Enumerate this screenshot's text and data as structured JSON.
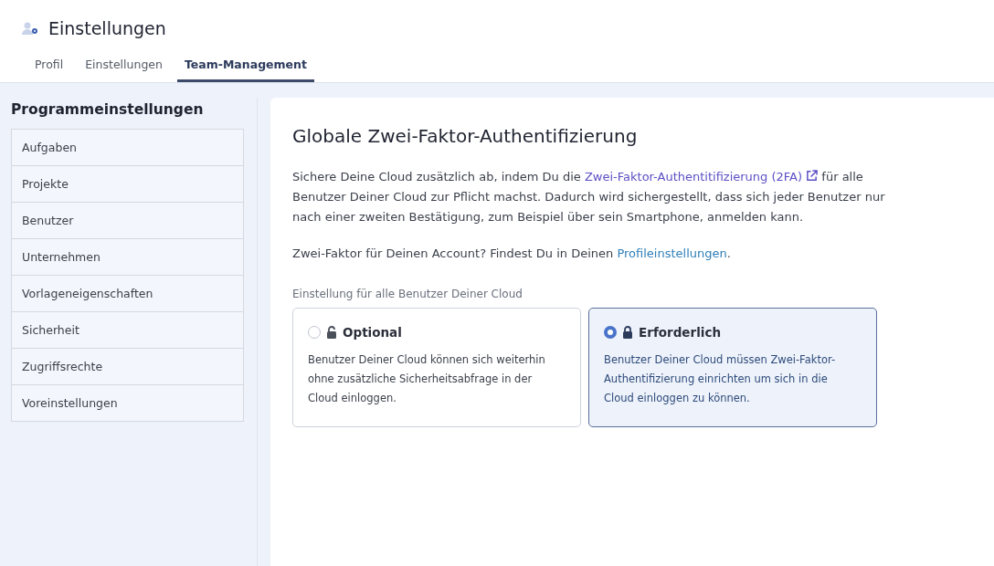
{
  "header": {
    "title": "Einstellungen"
  },
  "tabs": [
    {
      "label": "Profil",
      "selected": false
    },
    {
      "label": "Einstellungen",
      "selected": false
    },
    {
      "label": "Team-Management",
      "selected": true
    }
  ],
  "sidebar": {
    "title": "Programmeinstellungen",
    "items": [
      {
        "label": "Aufgaben",
        "selected": false
      },
      {
        "label": "Projekte",
        "selected": false
      },
      {
        "label": "Benutzer",
        "selected": false
      },
      {
        "label": "Unternehmen",
        "selected": false
      },
      {
        "label": "Vorlageneigenschaften",
        "selected": false
      },
      {
        "label": "Sicherheit",
        "selected": false
      },
      {
        "label": "Zugriffsrechte",
        "selected": false
      },
      {
        "label": "Voreinstellungen",
        "selected": false
      }
    ]
  },
  "content": {
    "heading": "Globale Zwei-Faktor-Authentifizierung",
    "intro": {
      "before": "Sichere Deine Cloud zusätzlich ab, indem Du die ",
      "link": "Zwei-Faktor-Authentitifizierung (2FA)",
      "after": " für alle Benutzer Deiner Cloud zur Pflicht machst. Dadurch wird sichergestellt, dass sich jeder Benutzer nur nach einer zweiten Bestätigung, zum Beispiel über sein Smartphone, anmelden kann."
    },
    "account_note": {
      "before": "Zwei-Faktor für Deinen Account? Findest Du in Deinen ",
      "link": "Profileinstellungen",
      "after": "."
    },
    "options_label": "Einstellung für alle Benutzer Deiner Cloud",
    "options": [
      {
        "title": "Optional",
        "locked": false,
        "selected": false,
        "description": "Benutzer Deiner Cloud können sich weiterhin ohne zusätzliche Sicherheitsabfrage in der Cloud einloggen."
      },
      {
        "title": "Erforderlich",
        "locked": true,
        "selected": true,
        "description": "Benutzer Deiner Cloud müssen Zwei-Faktor-Authentifizierung einrichten um sich in die Cloud einloggen zu können."
      }
    ]
  }
}
